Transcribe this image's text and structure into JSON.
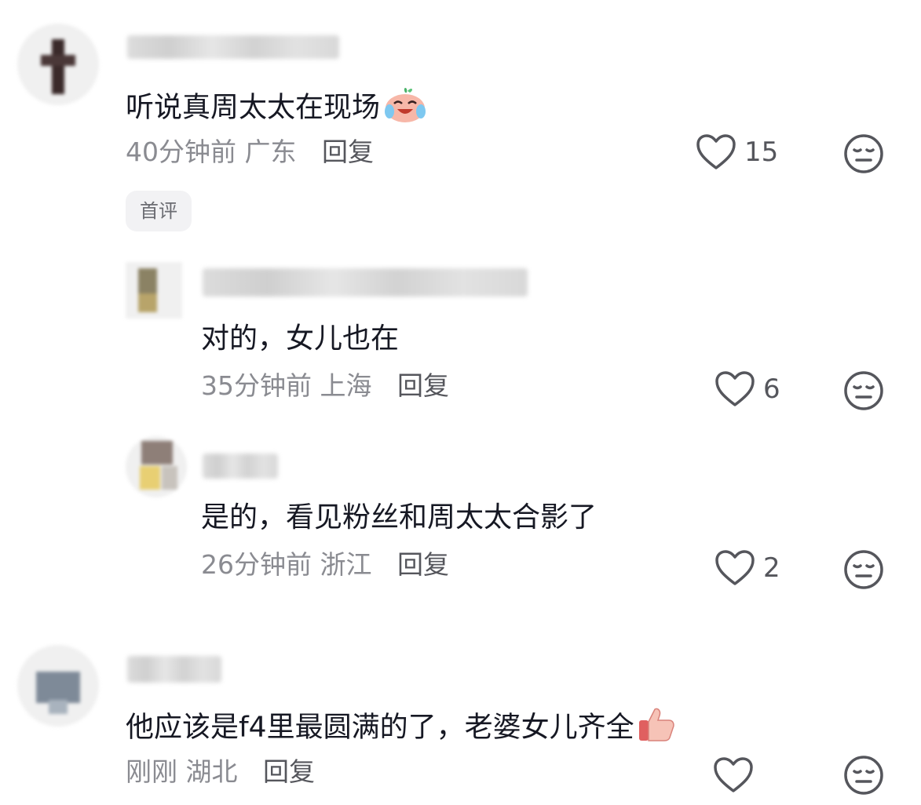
{
  "comments": [
    {
      "text": "听说真周太太在现场",
      "emoji": "crying-laughing-peach-emoji",
      "time": "40分钟前",
      "region": "广东",
      "reply": "回复",
      "likes": "15",
      "badge": "首评"
    },
    {
      "text": "对的，女儿也在",
      "time": "35分钟前",
      "region": "上海",
      "reply": "回复",
      "likes": "6"
    },
    {
      "text": "是的，看见粉丝和周太太合影了",
      "time": "26分钟前",
      "region": "浙江",
      "reply": "回复",
      "likes": "2"
    },
    {
      "text": "他应该是f4里最圆满的了，老婆女儿齐全",
      "emoji": "thumbs-up-emoji",
      "time": "刚刚",
      "region": "湖北",
      "reply": "回复",
      "likes": ""
    }
  ],
  "colors": {
    "text": "#161823",
    "meta": "#8a8b91",
    "reply": "#55565c",
    "icon": "#55565c"
  }
}
